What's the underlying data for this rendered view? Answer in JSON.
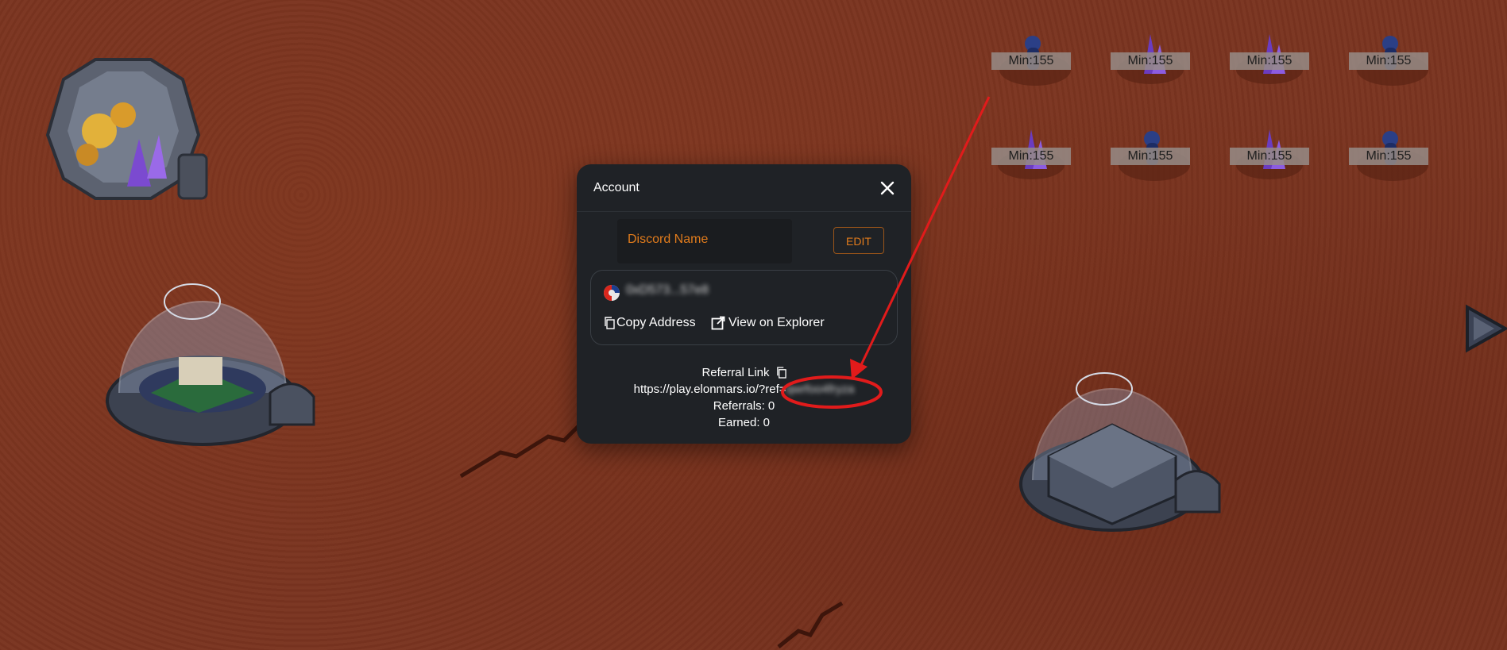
{
  "colors": {
    "ground": "#7a3420",
    "modal_bg": "#1f2226",
    "accent_orange": "#e07b1c",
    "annotation_red": "#e11b1b"
  },
  "resources": [
    {
      "label": "Min:155",
      "icon": "blue-ore-icon"
    },
    {
      "label": "Min:155",
      "icon": "purple-crystal-icon"
    },
    {
      "label": "Min:155",
      "icon": "purple-crystal-icon"
    },
    {
      "label": "Min:155",
      "icon": "blue-ore-icon"
    },
    {
      "label": "Min:155",
      "icon": "purple-crystal-icon"
    },
    {
      "label": "Min:155",
      "icon": "blue-ore-icon"
    },
    {
      "label": "Min:155",
      "icon": "purple-crystal-icon"
    },
    {
      "label": "Min:155",
      "icon": "blue-ore-icon"
    }
  ],
  "modal": {
    "title": "Account",
    "close_icon": "close-icon",
    "discord_placeholder": "Discord Name",
    "edit_label": "EDIT",
    "wallet_address": "0xD573...57e8",
    "copy_address_label": "Copy Address",
    "view_explorer_label": "View on Explorer",
    "referral_title": "Referral Link",
    "referral_url": "https://play.elonmars.io/?ref=",
    "referral_code": "qwrfoo4fryza",
    "referrals": "Referrals: 0",
    "earned": "Earned: 0"
  }
}
